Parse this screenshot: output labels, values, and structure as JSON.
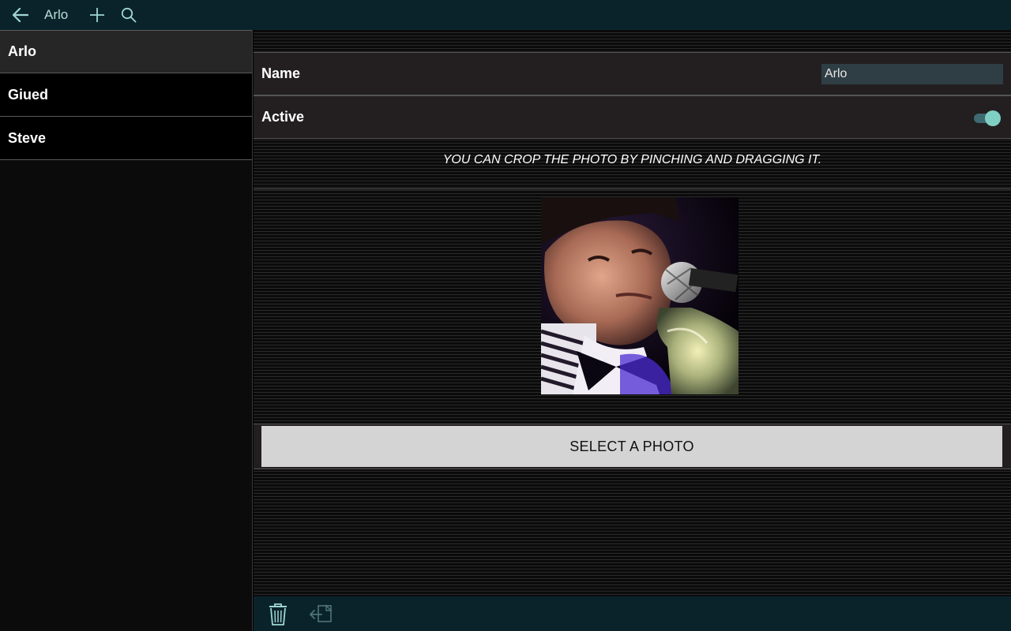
{
  "appbar": {
    "title": "Arlo",
    "back_icon": "arrow-left-icon",
    "add_icon": "plus-icon",
    "search_icon": "search-icon",
    "color": "#9fd6d2"
  },
  "sidebar": {
    "items": [
      {
        "label": "Arlo",
        "selected": true
      },
      {
        "label": "Giued",
        "selected": false
      },
      {
        "label": "Steve",
        "selected": false
      }
    ]
  },
  "detail": {
    "name_label": "Name",
    "name_value": "Arlo",
    "active_label": "Active",
    "active_on": true,
    "hint": "YOU CAN CROP THE PHOTO BY PINCHING AND DRAGGING IT.",
    "select_photo_label": "SELECT A PHOTO",
    "accent_color": "#7fcfc4"
  },
  "bottombar": {
    "trash_icon": "trash-icon",
    "export_icon": "export-icon"
  }
}
